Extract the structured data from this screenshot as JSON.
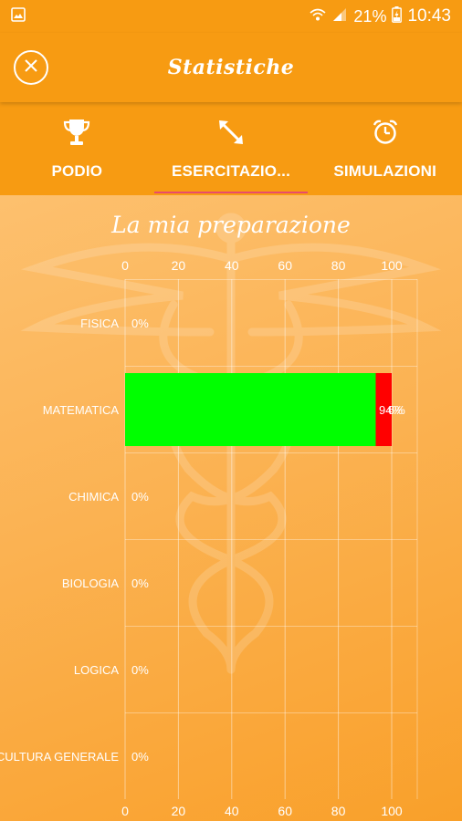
{
  "statusbar": {
    "battery_percent": "21%",
    "time": "10:43"
  },
  "appbar": {
    "title": "Statistiche",
    "close_icon": "close-circle-icon"
  },
  "tabs": [
    {
      "label": "PODIO",
      "icon": "trophy-icon",
      "active": false
    },
    {
      "label": "ESERCITAZIO...",
      "icon": "arrows-expand-icon",
      "active": true
    },
    {
      "label": "SIMULAZIONI",
      "icon": "alarm-clock-icon",
      "active": false
    }
  ],
  "colors": {
    "primary": "#f79b12",
    "tab_indicator": "#e94b6b",
    "correct": "#00ff00",
    "wrong": "#ff0000"
  },
  "chart_data": {
    "type": "bar",
    "orientation": "horizontal",
    "stacked": true,
    "title": "La mia preparazione",
    "categories": [
      "FISICA",
      "MATEMATICA",
      "CHIMICA",
      "BIOLOGIA",
      "LOGICA",
      "CULTURA GENERALE"
    ],
    "series": [
      {
        "color": "#00ff00",
        "values": [
          0,
          94,
          0,
          0,
          0,
          0
        ]
      },
      {
        "color": "#ff0000",
        "values": [
          0,
          6,
          0,
          0,
          0,
          0
        ]
      }
    ],
    "value_labels": [
      "0%",
      "94%",
      "0%",
      "0%",
      "0%",
      "0%"
    ],
    "extra_labels": [
      null,
      "6%",
      null,
      null,
      null,
      null
    ],
    "xlim": [
      0,
      100
    ],
    "xticks": [
      "0",
      "20",
      "40",
      "60",
      "80",
      "100"
    ],
    "grid": true,
    "legend": "none"
  }
}
